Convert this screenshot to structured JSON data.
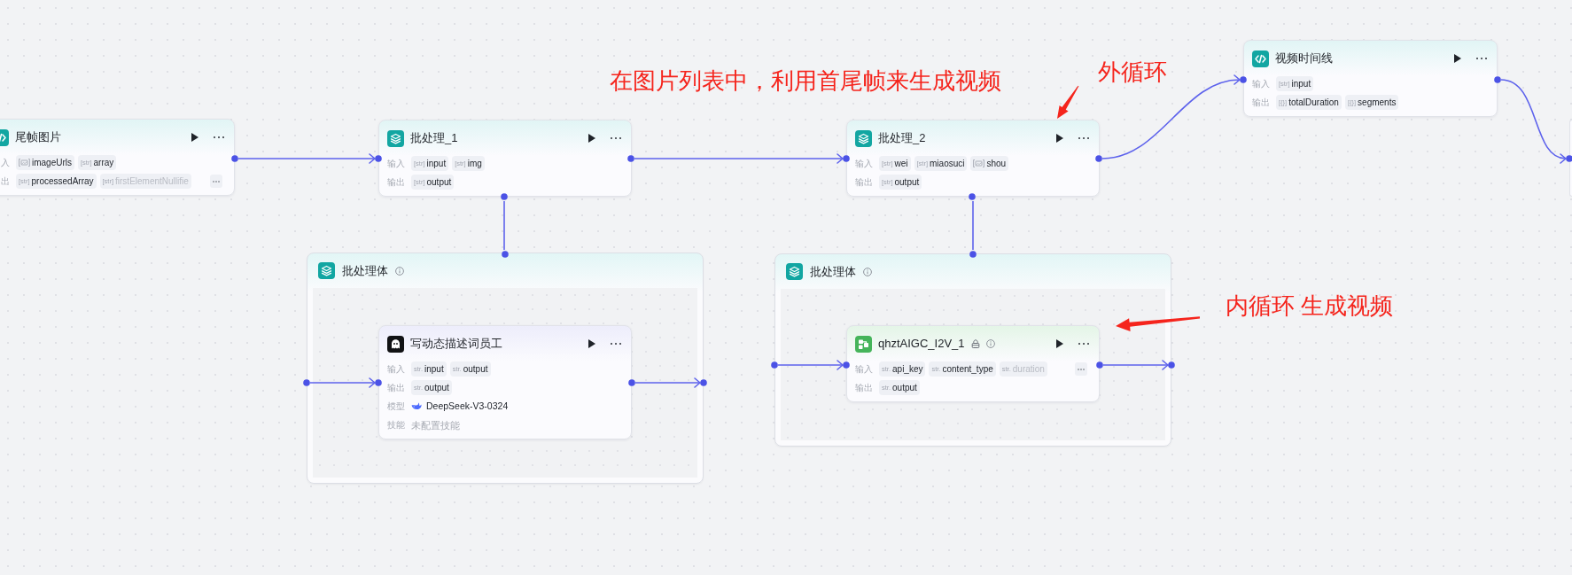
{
  "annotations": [
    {
      "text": "在图片列表中，利用首尾帧来生成视频"
    },
    {
      "text": "外循环"
    },
    {
      "text": "内循环 生成视频"
    }
  ],
  "nodes": [
    {
      "kind": "code",
      "title": "尾帧图片",
      "locked": false,
      "info": false,
      "rows": [
        {
          "kind": "params",
          "label": "入",
          "more_button": false,
          "chips": [
            {
              "kind": "image_list",
              "name": "imageUrls",
              "faded": false
            },
            {
              "kind": "typed",
              "type_label": "[str]",
              "name": "array",
              "faded": false
            }
          ]
        },
        {
          "kind": "params",
          "label": "出",
          "more_button": true,
          "chips": [
            {
              "kind": "typed",
              "type_label": "[str]",
              "name": "processedArray",
              "faded": false
            },
            {
              "kind": "typed",
              "type_label": "[str]",
              "name": "firstElementNullifie",
              "faded": true
            }
          ]
        }
      ]
    },
    {
      "kind": "batch",
      "title": "批处理_1",
      "locked": false,
      "info": false,
      "rows": [
        {
          "kind": "params",
          "label": "输入",
          "more_button": false,
          "chips": [
            {
              "kind": "typed",
              "type_label": "[str]",
              "name": "input",
              "faded": false
            },
            {
              "kind": "typed",
              "type_label": "[str]",
              "name": "img",
              "faded": false
            }
          ]
        },
        {
          "kind": "params",
          "label": "输出",
          "more_button": false,
          "chips": [
            {
              "kind": "typed",
              "type_label": "[str]",
              "name": "output",
              "faded": false
            }
          ]
        }
      ],
      "body": {
        "title": "批处理体",
        "info": true,
        "children": [
          {
            "kind": "agent",
            "title": "写动态描述词员工",
            "locked": false,
            "info": false,
            "rows": [
              {
                "kind": "params",
                "label": "输入",
                "more_button": false,
                "chips": [
                  {
                    "kind": "typed",
                    "type_label": "str.",
                    "name": "input",
                    "faded": false
                  },
                  {
                    "kind": "typed",
                    "type_label": "str.",
                    "name": "output",
                    "faded": false
                  }
                ]
              },
              {
                "kind": "params",
                "label": "输出",
                "more_button": false,
                "chips": [
                  {
                    "kind": "typed",
                    "type_label": "str.",
                    "name": "output",
                    "faded": false
                  }
                ]
              },
              {
                "kind": "model",
                "label": "模型",
                "value": "DeepSeek-V3-0324"
              },
              {
                "kind": "text",
                "label": "技能",
                "value": "未配置技能"
              }
            ]
          }
        ]
      }
    },
    {
      "kind": "batch",
      "title": "批处理_2",
      "locked": false,
      "info": false,
      "rows": [
        {
          "kind": "params",
          "label": "输入",
          "more_button": false,
          "chips": [
            {
              "kind": "typed",
              "type_label": "[str]",
              "name": "wei",
              "faded": false
            },
            {
              "kind": "typed",
              "type_label": "[str]",
              "name": "miaosuci",
              "faded": false
            },
            {
              "kind": "image_list",
              "name": "shou",
              "faded": false
            }
          ]
        },
        {
          "kind": "params",
          "label": "输出",
          "more_button": false,
          "chips": [
            {
              "kind": "typed",
              "type_label": "[str]",
              "name": "output",
              "faded": false
            }
          ]
        }
      ],
      "body": {
        "title": "批处理体",
        "info": true,
        "children": [
          {
            "kind": "plugin",
            "title": "qhztAIGC_I2V_1",
            "locked": true,
            "info": true,
            "rows": [
              {
                "kind": "params",
                "label": "输入",
                "more_button": true,
                "chips": [
                  {
                    "kind": "typed",
                    "type_label": "str.",
                    "name": "api_key",
                    "faded": false
                  },
                  {
                    "kind": "typed",
                    "type_label": "str.",
                    "name": "content_type",
                    "faded": false
                  },
                  {
                    "kind": "typed",
                    "type_label": "str.",
                    "name": "duration",
                    "faded": true
                  }
                ]
              },
              {
                "kind": "params",
                "label": "输出",
                "more_button": false,
                "chips": [
                  {
                    "kind": "typed",
                    "type_label": "str.",
                    "name": "output",
                    "faded": false
                  }
                ]
              }
            ]
          }
        ]
      }
    },
    {
      "kind": "code",
      "title": "视频时间线",
      "locked": false,
      "info": false,
      "rows": [
        {
          "kind": "params",
          "label": "输入",
          "more_button": false,
          "chips": [
            {
              "kind": "typed",
              "type_label": "[str]",
              "name": "input",
              "faded": false
            }
          ]
        },
        {
          "kind": "params",
          "label": "输出",
          "more_button": false,
          "chips": [
            {
              "kind": "typed",
              "type_label": "[{}]",
              "name": "totalDuration",
              "faded": false
            },
            {
              "kind": "typed",
              "type_label": "[{}]",
              "name": "segments",
              "faded": false
            }
          ]
        }
      ]
    }
  ]
}
